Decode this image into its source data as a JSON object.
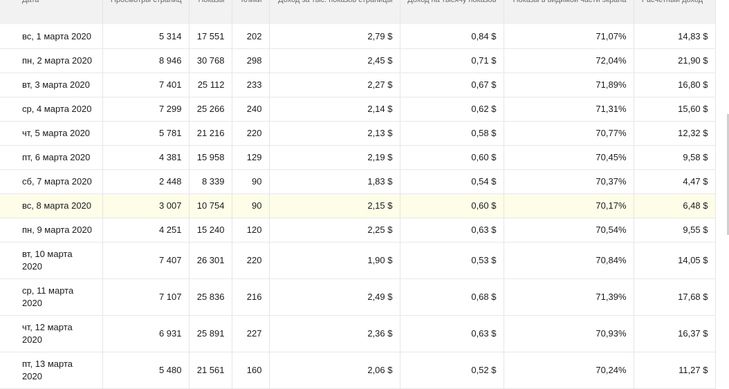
{
  "columns": [
    {
      "id": "date",
      "label": "Дата"
    },
    {
      "id": "pageviews",
      "label": "Просмотры страниц"
    },
    {
      "id": "impressions",
      "label": "Показы"
    },
    {
      "id": "clicks",
      "label": "Клики"
    },
    {
      "id": "rpm",
      "label": "Доход за тыс. показов страницы"
    },
    {
      "id": "ecpm",
      "label": "Доход на тысячу показов"
    },
    {
      "id": "viewability",
      "label": "Показы в видимой части экрана"
    },
    {
      "id": "earnings",
      "label": "Расчетный доход *"
    }
  ],
  "rows": [
    {
      "date": "вс, 1 марта 2020",
      "pageviews": "5 314",
      "impressions": "17 551",
      "clicks": "202",
      "rpm": "2,79 $",
      "ecpm": "0,84 $",
      "viewability": "71,07%",
      "earnings": "14,83 $"
    },
    {
      "date": "пн, 2 марта 2020",
      "pageviews": "8 946",
      "impressions": "30 768",
      "clicks": "298",
      "rpm": "2,45 $",
      "ecpm": "0,71 $",
      "viewability": "72,04%",
      "earnings": "21,90 $"
    },
    {
      "date": "вт, 3 марта 2020",
      "pageviews": "7 401",
      "impressions": "25 112",
      "clicks": "233",
      "rpm": "2,27 $",
      "ecpm": "0,67 $",
      "viewability": "71,89%",
      "earnings": "16,80 $"
    },
    {
      "date": "ср, 4 марта 2020",
      "pageviews": "7 299",
      "impressions": "25 266",
      "clicks": "240",
      "rpm": "2,14 $",
      "ecpm": "0,62 $",
      "viewability": "71,31%",
      "earnings": "15,60 $"
    },
    {
      "date": "чт, 5 марта 2020",
      "pageviews": "5 781",
      "impressions": "21 216",
      "clicks": "220",
      "rpm": "2,13 $",
      "ecpm": "0,58 $",
      "viewability": "70,77%",
      "earnings": "12,32 $"
    },
    {
      "date": "пт, 6 марта 2020",
      "pageviews": "4 381",
      "impressions": "15 958",
      "clicks": "129",
      "rpm": "2,19 $",
      "ecpm": "0,60 $",
      "viewability": "70,45%",
      "earnings": "9,58 $"
    },
    {
      "date": "сб, 7 марта 2020",
      "pageviews": "2 448",
      "impressions": "8 339",
      "clicks": "90",
      "rpm": "1,83 $",
      "ecpm": "0,54 $",
      "viewability": "70,37%",
      "earnings": "4,47 $"
    },
    {
      "date": "вс, 8 марта 2020",
      "pageviews": "3 007",
      "impressions": "10 754",
      "clicks": "90",
      "rpm": "2,15 $",
      "ecpm": "0,60 $",
      "viewability": "70,17%",
      "earnings": "6,48 $"
    },
    {
      "date": "пн, 9 марта 2020",
      "pageviews": "4 251",
      "impressions": "15 240",
      "clicks": "120",
      "rpm": "2,25 $",
      "ecpm": "0,63 $",
      "viewability": "70,54%",
      "earnings": "9,55 $"
    },
    {
      "date": "вт, 10 марта 2020",
      "pageviews": "7 407",
      "impressions": "26 301",
      "clicks": "220",
      "rpm": "1,90 $",
      "ecpm": "0,53 $",
      "viewability": "70,84%",
      "earnings": "14,05 $"
    },
    {
      "date": "ср, 11 марта 2020",
      "pageviews": "7 107",
      "impressions": "25 836",
      "clicks": "216",
      "rpm": "2,49 $",
      "ecpm": "0,68 $",
      "viewability": "71,39%",
      "earnings": "17,68 $"
    },
    {
      "date": "чт, 12 марта 2020",
      "pageviews": "6 931",
      "impressions": "25 891",
      "clicks": "227",
      "rpm": "2,36 $",
      "ecpm": "0,63 $",
      "viewability": "70,93%",
      "earnings": "16,37 $"
    },
    {
      "date": "пт, 13 марта 2020",
      "pageviews": "5 480",
      "impressions": "21 561",
      "clicks": "160",
      "rpm": "2,06 $",
      "ecpm": "0,52 $",
      "viewability": "70,24%",
      "earnings": "11,27 $"
    }
  ]
}
